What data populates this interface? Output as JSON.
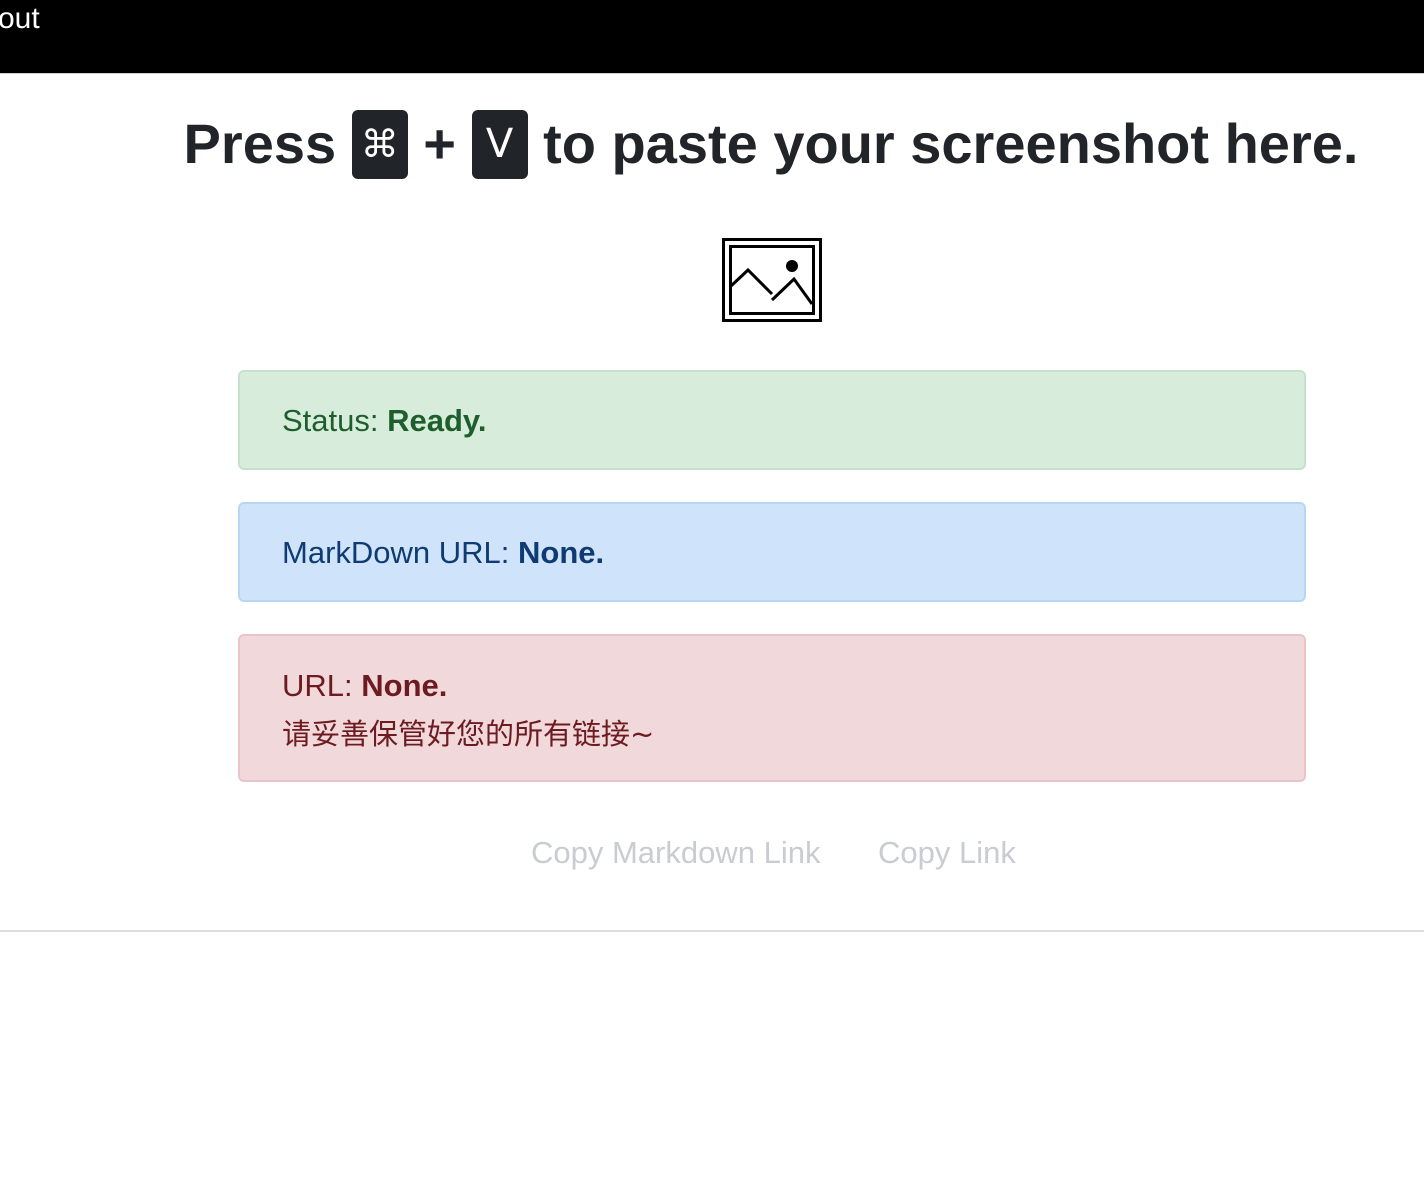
{
  "nav": {
    "link_label": "out"
  },
  "headline": {
    "prefix": "Press",
    "key1": "⌘",
    "plus": "+",
    "key2": "V",
    "suffix": "to paste your screenshot here."
  },
  "image_placeholder": {
    "icon": "image-icon"
  },
  "status_alert": {
    "label": "Status:",
    "value": "Ready.",
    "color": "#d8ecdc"
  },
  "markdown_alert": {
    "label": "MarkDown URL:",
    "value": "None.",
    "color": "#cfe4fb"
  },
  "url_alert": {
    "label": "URL:",
    "value": "None.",
    "note": "请妥善保管好您的所有链接~",
    "color": "#f1d8db"
  },
  "actions": {
    "copy_markdown_label": "Copy Markdown Link",
    "copy_link_label": "Copy Link"
  }
}
